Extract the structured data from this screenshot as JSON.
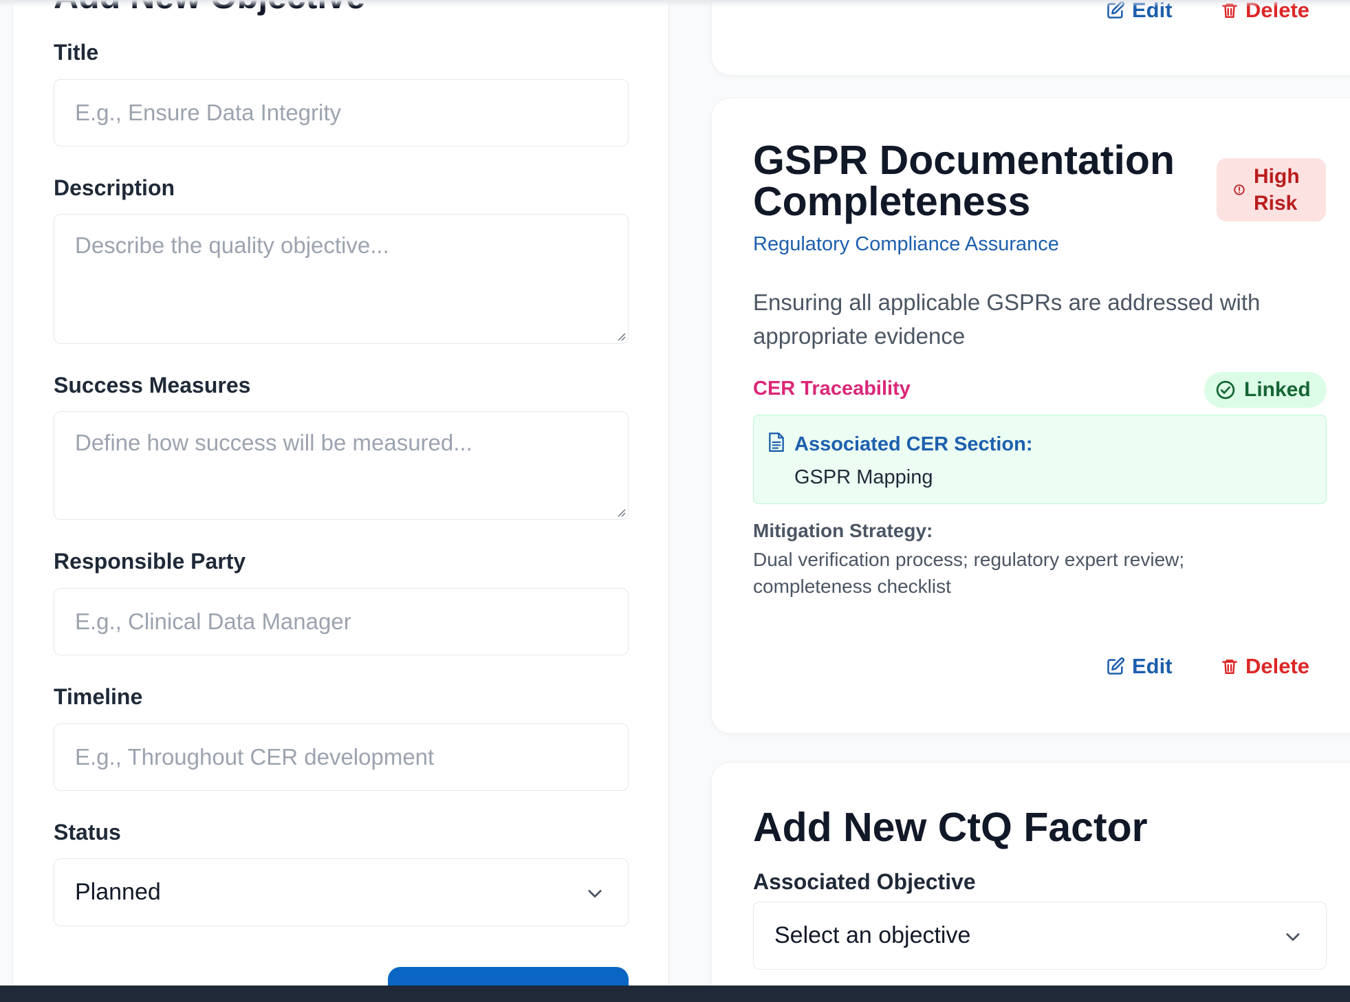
{
  "objective_form": {
    "heading": "Add New Objective",
    "title_label": "Title",
    "title_placeholder": "E.g., Ensure Data Integrity",
    "description_label": "Description",
    "description_placeholder": "Describe the quality objective...",
    "success_label": "Success Measures",
    "success_placeholder": "Define how success will be measured...",
    "responsible_label": "Responsible Party",
    "responsible_placeholder": "E.g., Clinical Data Manager",
    "timeline_label": "Timeline",
    "timeline_placeholder": "E.g., Throughout CER development",
    "status_label": "Status",
    "status_value": "Planned"
  },
  "prev_card": {
    "edit_label": "Edit",
    "delete_label": "Delete"
  },
  "objective_card": {
    "title": "GSPR Documentation Completeness",
    "risk_badge": "High Risk",
    "category": "Regulatory Compliance Assurance",
    "description": "Ensuring all applicable GSPRs are addressed with appropriate evidence",
    "traceability_label": "CER Traceability",
    "linked_label": "Linked",
    "cer_section_label": "Associated CER Section:",
    "cer_section_value": "GSPR Mapping",
    "mitigation_label": "Mitigation Strategy:",
    "mitigation_text": "Dual verification process; regulatory expert review; completeness checklist",
    "edit_label": "Edit",
    "delete_label": "Delete"
  },
  "ctq_form": {
    "heading": "Add New CtQ Factor",
    "objective_label": "Associated Objective",
    "objective_value": "Select an objective"
  },
  "colors": {
    "primary": "#0a66c2",
    "danger": "#dc2626",
    "risk_bg": "#fde2e2",
    "linked_bg": "#dcfce7",
    "traceability": "#db2777"
  }
}
